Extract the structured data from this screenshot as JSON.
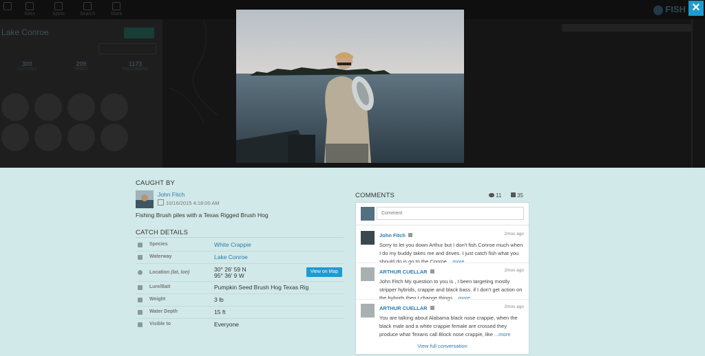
{
  "background": {
    "nav": [
      "Sites",
      "Spots",
      "Search",
      "Store"
    ],
    "lake_title": "Lake Conroe",
    "stats": [
      {
        "value": "300",
        "label": "CATCHES"
      },
      {
        "value": "209",
        "label": "SPOTS"
      },
      {
        "value": "1173",
        "label": "FOLLOWERS"
      }
    ]
  },
  "close": {
    "glyph": "✕"
  },
  "caught_by": {
    "heading": "CAUGHT BY",
    "name": "John Fitch",
    "date": "10/16/2015 4:18:00 AM",
    "description": "Fishing Brush piles with a Texas Rigged Brush Hog"
  },
  "catch_details": {
    "heading": "CATCH DETAILS",
    "rows": [
      {
        "label": "Species",
        "value": "White Crappie"
      },
      {
        "label": "Waterway",
        "value": "Lake Conroe"
      },
      {
        "label": "Location",
        "label_suffix": "(lat, lon)",
        "value": "30° 26' 59 N",
        "value2": "95° 36' 9 W"
      },
      {
        "label": "Lure/Bait",
        "value": "Pumpkin Seed Brush Hog Texas Rig"
      },
      {
        "label": "Weight",
        "value": "3 lb"
      },
      {
        "label": "Water Depth",
        "value": "15 ft"
      },
      {
        "label": "Visible to",
        "value": "Everyone"
      }
    ],
    "map_button": "View on Map"
  },
  "comments": {
    "heading": "COMMENTS",
    "comment_count": "11",
    "like_count": "35",
    "placeholder": "Comment",
    "items": [
      {
        "author": "John Fitch",
        "time": "2mos ago",
        "text": "Sorry to let you down Arthur but I don't fish Conroe much when I do my buddy takes me and drives. I just catch fish what you should do is go to the Conroe",
        "more": "...more"
      },
      {
        "author": "ARTHUR CUELLAR",
        "time": "2mos ago",
        "text": "John Fitch My question to you is , I been targeting mostly stripper hybrids, crappie and black bass. if I don't get action on the hybrids then I change things",
        "more": "...more"
      },
      {
        "author": "ARTHUR CUELLAR",
        "time": "2mos ago",
        "text": "You are talking about Alabama black nose crappie, when the black male and a white crappie female are crossed they produce what Texans call Block nose crappie, like",
        "more": "...more"
      }
    ],
    "view_full": "View full conversation"
  },
  "colors": {
    "accent": "#1e9bd0",
    "link": "#2a7ab0",
    "panel_bg": "#d1e9e8"
  }
}
